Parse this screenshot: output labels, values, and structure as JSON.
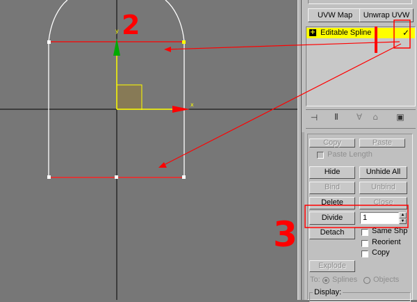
{
  "toolbar": {
    "uvw_map_label": "UVW Map",
    "unwrap_uvw_label": "Unwrap UVW"
  },
  "stack": {
    "expand_symbol": "+",
    "item_label": "Editable Spline"
  },
  "stack_tools": {
    "pin_icon": "pin-stack-icon",
    "show_end_icon": "show-end-result-icon",
    "unique_icon": "make-unique-icon",
    "remove_icon": "remove-modifier-icon",
    "configure_icon": "configure-modifier-sets-icon"
  },
  "geometry": {
    "copy_label": "Copy",
    "paste_label": "Paste",
    "paste_length_label": "Paste Length",
    "hide_label": "Hide",
    "unhide_all_label": "Unhide All",
    "bind_label": "Bind",
    "unbind_label": "Unbind",
    "delete_label": "Delete",
    "close_label": "Close",
    "divide_label": "Divide",
    "divide_value": "1",
    "detach_label": "Detach",
    "same_shp_label": "Same Shp",
    "reorient_label": "Reorient",
    "copy_check_label": "Copy",
    "explode_label": "Explode",
    "to_label": "To:",
    "splines_label": "Splines",
    "objects_label": "Objects",
    "display_label": "Display:"
  },
  "annotations": {
    "step2": "2",
    "step3": "3"
  },
  "gizmo": {
    "x_label": "x",
    "y_label": "y"
  },
  "colors": {
    "annotation": "#ff0000",
    "stack_highlight": "#ffff00",
    "gizmo_x": "#ff0000",
    "gizmo_y": "#00aa00",
    "gizmo_axis": "#ffff00",
    "viewport_bg": "#777777",
    "panel_bg": "#c0c0c0"
  }
}
